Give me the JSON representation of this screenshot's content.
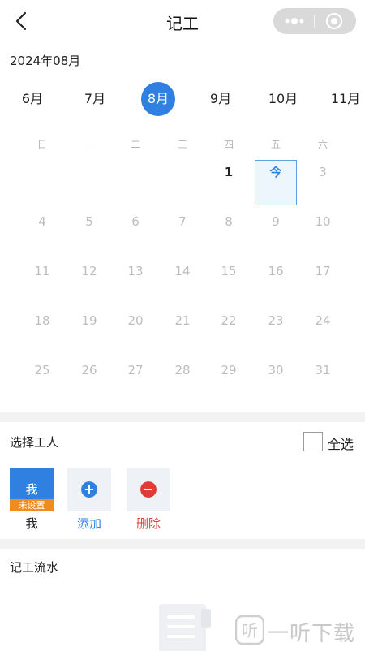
{
  "nav": {
    "title": "记工"
  },
  "calendar": {
    "year_month": "2024年08月",
    "months": [
      {
        "label": "6月",
        "selected": false
      },
      {
        "label": "7月",
        "selected": false
      },
      {
        "label": "8月",
        "selected": true
      },
      {
        "label": "9月",
        "selected": false
      },
      {
        "label": "10月",
        "selected": false
      },
      {
        "label": "11月",
        "selected": false
      }
    ],
    "weekdays": [
      "日",
      "一",
      "二",
      "三",
      "四",
      "五",
      "六"
    ],
    "days": [
      {
        "label": "1",
        "col": 4,
        "row": 0,
        "style": "dark"
      },
      {
        "label": "今",
        "col": 5,
        "row": 0,
        "style": "today"
      },
      {
        "label": "3",
        "col": 6,
        "row": 0,
        "style": "muted"
      },
      {
        "label": "4",
        "col": 0,
        "row": 1,
        "style": "muted"
      },
      {
        "label": "5",
        "col": 1,
        "row": 1,
        "style": "muted"
      },
      {
        "label": "6",
        "col": 2,
        "row": 1,
        "style": "muted"
      },
      {
        "label": "7",
        "col": 3,
        "row": 1,
        "style": "muted"
      },
      {
        "label": "8",
        "col": 4,
        "row": 1,
        "style": "muted"
      },
      {
        "label": "9",
        "col": 5,
        "row": 1,
        "style": "muted"
      },
      {
        "label": "10",
        "col": 6,
        "row": 1,
        "style": "muted"
      },
      {
        "label": "11",
        "col": 0,
        "row": 2,
        "style": "muted"
      },
      {
        "label": "12",
        "col": 1,
        "row": 2,
        "style": "muted"
      },
      {
        "label": "13",
        "col": 2,
        "row": 2,
        "style": "muted"
      },
      {
        "label": "14",
        "col": 3,
        "row": 2,
        "style": "muted"
      },
      {
        "label": "15",
        "col": 4,
        "row": 2,
        "style": "muted"
      },
      {
        "label": "16",
        "col": 5,
        "row": 2,
        "style": "muted"
      },
      {
        "label": "17",
        "col": 6,
        "row": 2,
        "style": "muted"
      },
      {
        "label": "18",
        "col": 0,
        "row": 3,
        "style": "muted"
      },
      {
        "label": "19",
        "col": 1,
        "row": 3,
        "style": "muted"
      },
      {
        "label": "20",
        "col": 2,
        "row": 3,
        "style": "muted"
      },
      {
        "label": "21",
        "col": 3,
        "row": 3,
        "style": "muted"
      },
      {
        "label": "22",
        "col": 4,
        "row": 3,
        "style": "muted"
      },
      {
        "label": "23",
        "col": 5,
        "row": 3,
        "style": "muted"
      },
      {
        "label": "24",
        "col": 6,
        "row": 3,
        "style": "muted"
      },
      {
        "label": "25",
        "col": 0,
        "row": 4,
        "style": "muted"
      },
      {
        "label": "26",
        "col": 1,
        "row": 4,
        "style": "muted"
      },
      {
        "label": "27",
        "col": 2,
        "row": 4,
        "style": "muted"
      },
      {
        "label": "28",
        "col": 3,
        "row": 4,
        "style": "muted"
      },
      {
        "label": "29",
        "col": 4,
        "row": 4,
        "style": "muted"
      },
      {
        "label": "30",
        "col": 5,
        "row": 4,
        "style": "muted"
      },
      {
        "label": "31",
        "col": 6,
        "row": 4,
        "style": "muted"
      }
    ]
  },
  "workers": {
    "section_title": "选择工人",
    "select_all_label": "全选",
    "select_all_checked": false,
    "me": {
      "avatar_text": "我",
      "badge": "未设置",
      "caption": "我"
    },
    "add_label": "添加",
    "delete_label": "删除"
  },
  "records": {
    "section_title": "记工流水"
  },
  "watermark": {
    "text": "一听下载",
    "glyph": "听"
  },
  "colors": {
    "accent": "#2f80e0",
    "badge": "#f08c1f",
    "delete": "#e23b36",
    "add_text": "#2f80e0"
  },
  "icons": [
    "back-chevron-icon",
    "more-dots-icon",
    "close-target-icon",
    "plus-icon",
    "minus-icon",
    "document-icon"
  ]
}
